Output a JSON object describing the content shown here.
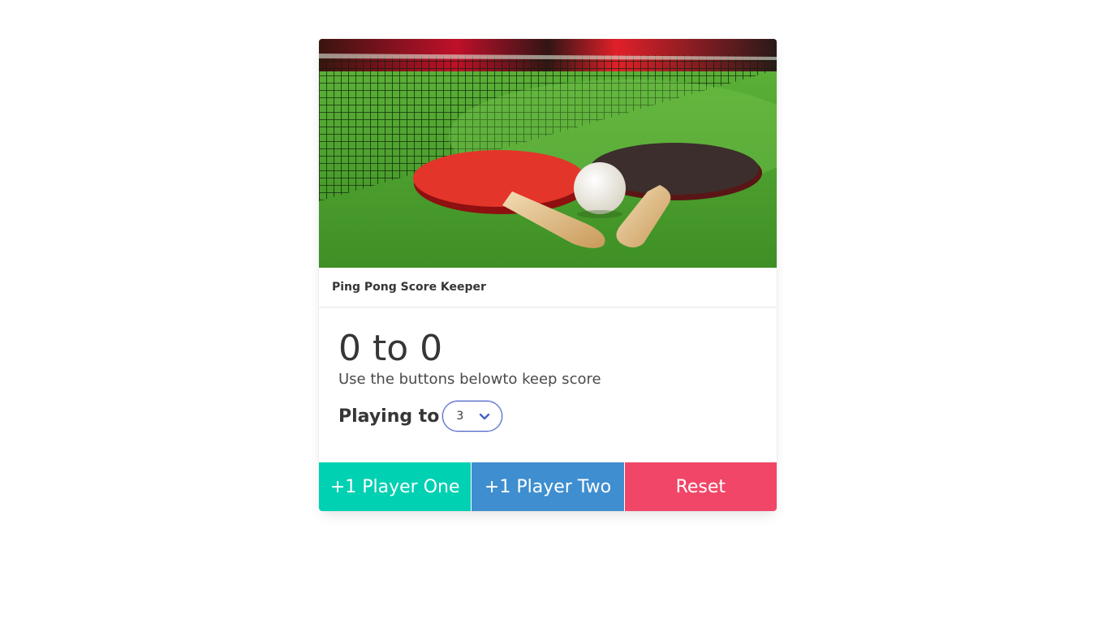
{
  "card": {
    "image": {
      "description_icon": "ping-pong-image"
    },
    "header_title": "Ping Pong Score Keeper",
    "score_text": "0 to 0",
    "subtitle": "Use the buttons belowto keep score",
    "playing_to_label": "Playing to",
    "playing_to_value": "3",
    "buttons": {
      "player_one": "+1 Player One",
      "player_two": "+1 Player Two",
      "reset": "Reset"
    }
  },
  "colors": {
    "player_one": "#00d1b2",
    "player_two": "#3e8ed0",
    "reset": "#f14668",
    "select_focus": "#485fc7"
  }
}
